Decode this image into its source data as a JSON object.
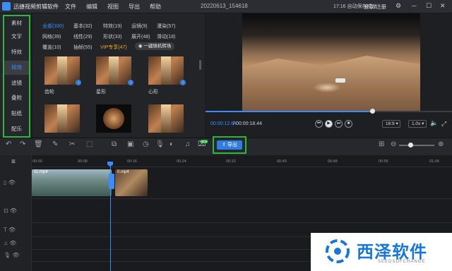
{
  "app": {
    "title": "迅捷视频剪辑软件",
    "project_name": "20220613_154618"
  },
  "menu": [
    "文件",
    "编辑",
    "视图",
    "导出",
    "帮助"
  ],
  "status": {
    "autosave": "17:16 自动保存成功",
    "login": "登录/注册"
  },
  "left_nav": {
    "items": [
      "素材",
      "文字",
      "特效",
      "转场",
      "滤镜",
      "叠附",
      "贴纸",
      "配乐"
    ],
    "active_index": 3
  },
  "categories": {
    "row1": [
      "全部(330)",
      "基本(32)",
      "特效(19)",
      "运镜(9)",
      "漫染(57)"
    ],
    "row2": [
      "网格(39)",
      "线性(29)",
      "形状(33)",
      "展开(48)",
      "滑动(18)"
    ],
    "row3": [
      "覆盖(10)",
      "抽帧(55)",
      "VIP专享(47)"
    ],
    "random_button": "一键随机转场"
  },
  "thumbnails": [
    {
      "label": "齿轮"
    },
    {
      "label": "星形"
    },
    {
      "label": "心形"
    },
    {
      "label": ""
    },
    {
      "label": ""
    },
    {
      "label": ""
    }
  ],
  "player": {
    "current_time": "00:00:12.64",
    "total_time": "00:00:18.44",
    "progress": 0.68,
    "aspect": "16:9",
    "speed": "1.0x"
  },
  "toolbar": {
    "export_label": "导出",
    "new_badge": "NEW"
  },
  "timeline": {
    "ticks": [
      "00:00",
      "00:08",
      "00:16",
      "00:24",
      "00:32",
      "00:40",
      "00:48",
      "00:56",
      "01:04"
    ],
    "clips": [
      {
        "label": "11.mp4"
      },
      {
        "label": "0.mp4"
      }
    ]
  },
  "watermark": {
    "cn": "西泽软件",
    "en": "SEEDSOFCHANGE"
  },
  "colors": {
    "accent": "#3b8cff",
    "highlight": "#2db83d",
    "vip": "#f5a623"
  }
}
